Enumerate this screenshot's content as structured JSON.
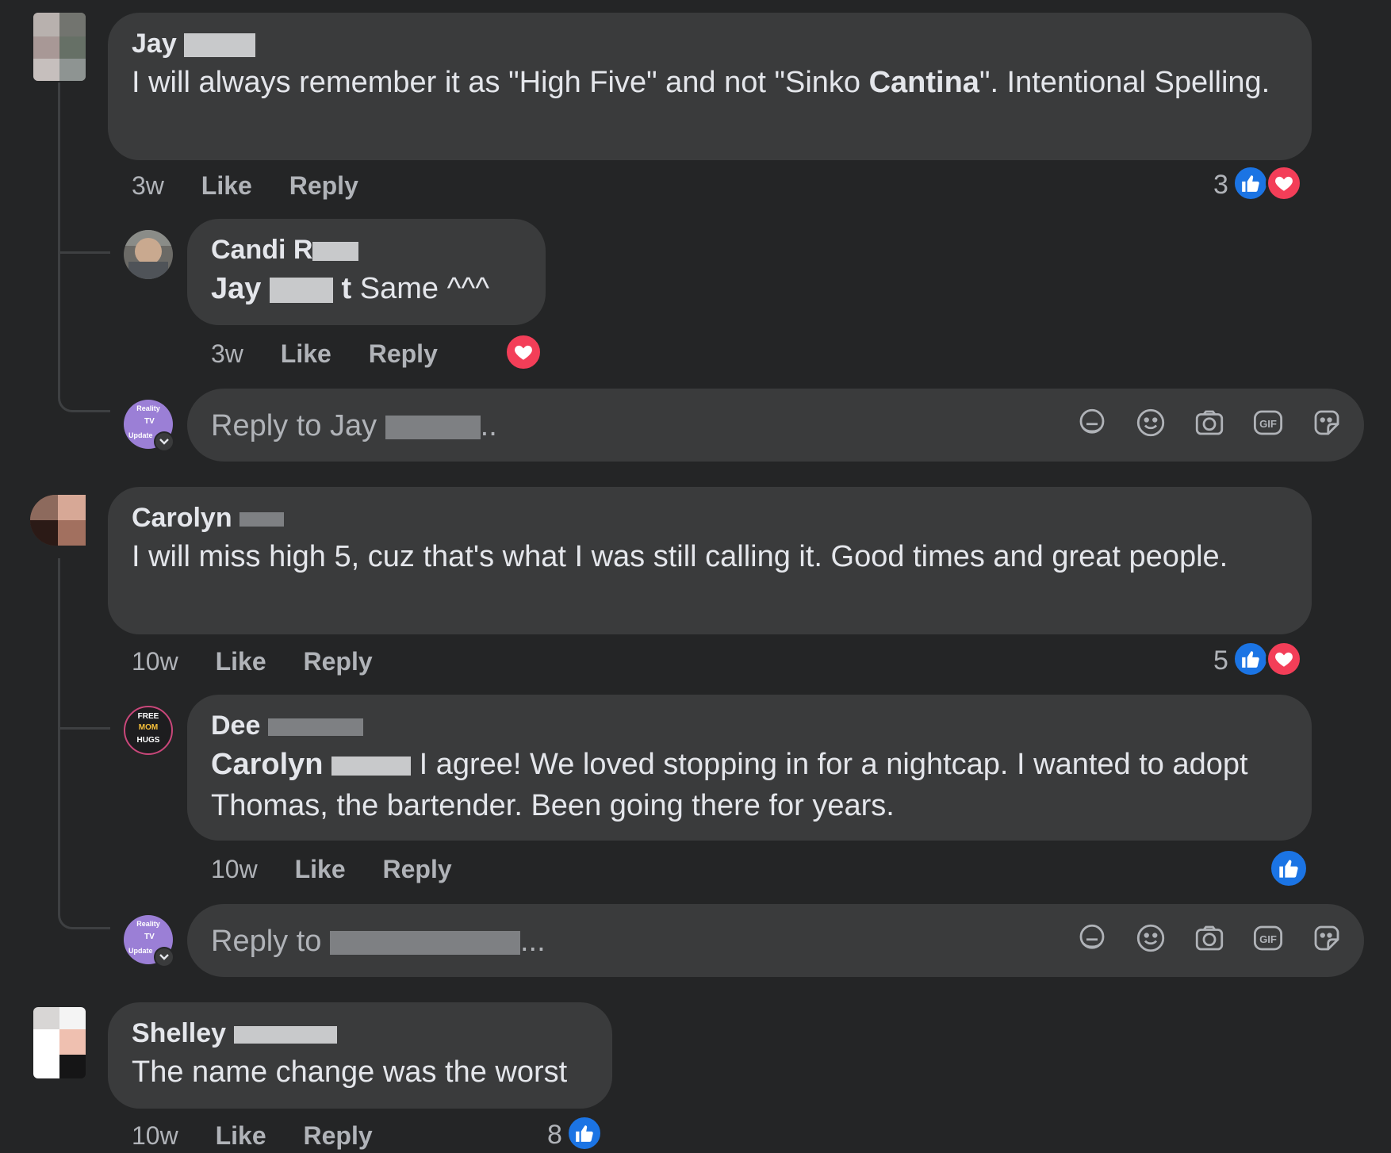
{
  "comments": [
    {
      "author": "Jay",
      "text_before": "I will always remember it as \"High Five\" and not \"Sinko ",
      "text_bold": "Cantina",
      "text_after": "\". Intentional Spelling.",
      "time": "3w",
      "like_label": "Like",
      "reply_label": "Reply",
      "reaction_count": "3",
      "reactions": [
        "like-icon",
        "love-icon"
      ],
      "replies": [
        {
          "author": "Candi",
          "author_suffix": "R",
          "mention": "Jay",
          "mention_tail": "t",
          "text": " Same ^^^",
          "time": "3w",
          "like_label": "Like",
          "reply_label": "Reply",
          "reactions": [
            "love-icon"
          ]
        }
      ],
      "composer_placeholder": "Reply to Jay",
      "composer_tail": ".."
    },
    {
      "author": "Carolyn",
      "text": "I will miss high 5, cuz that's what I was still calling it. Good times and great people.",
      "time": "10w",
      "like_label": "Like",
      "reply_label": "Reply",
      "reaction_count": "5",
      "reactions": [
        "like-icon",
        "love-icon"
      ],
      "replies": [
        {
          "author": "Dee",
          "mention": "Carolyn",
          "text": " I agree! We loved stopping in for a nightcap. I wanted to adopt Thomas, the bartender. Been going there for years.",
          "time": "10w",
          "like_label": "Like",
          "reply_label": "Reply",
          "reactions": [
            "like-icon"
          ]
        }
      ],
      "composer_placeholder": "Reply to",
      "composer_tail": "..."
    },
    {
      "author": "Shelley",
      "text": "The name change was the worst",
      "time": "10w",
      "like_label": "Like",
      "reply_label": "Reply",
      "reaction_count": "8",
      "reactions": [
        "like-icon"
      ]
    }
  ],
  "avatar_badges": {
    "dee": [
      "FREE",
      "MOM",
      "HUGS"
    ],
    "page": [
      "Reality",
      "TV",
      "Update"
    ]
  },
  "composer_tools": [
    "avatar-sticker-icon",
    "emoji-icon",
    "camera-icon",
    "gif-icon",
    "sticker-icon"
  ],
  "composer_gif_label": "GIF",
  "colors": {
    "background": "#242526",
    "bubble": "#3a3b3c",
    "like_blue": "#1b74e4",
    "love_red": "#f33e58",
    "secondary_text": "#b0b3b8"
  }
}
